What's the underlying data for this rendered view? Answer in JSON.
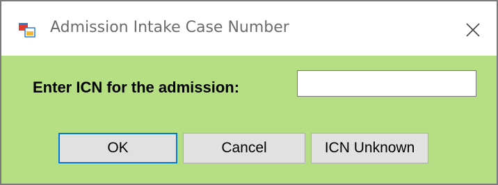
{
  "window": {
    "title": "Admission Intake Case Number",
    "icon": "windows-form-icon",
    "close_icon": "close-icon"
  },
  "form": {
    "prompt_label": "Enter ICN for the admission:",
    "icn_value": "",
    "icn_placeholder": ""
  },
  "buttons": {
    "ok_label": "OK",
    "cancel_label": "Cancel",
    "unknown_label": "ICN Unknown"
  },
  "colors": {
    "client_background": "#b6de83",
    "titlebar_background": "#ffffff",
    "default_button_border": "#0078d7",
    "button_background": "#e1e1e1"
  }
}
